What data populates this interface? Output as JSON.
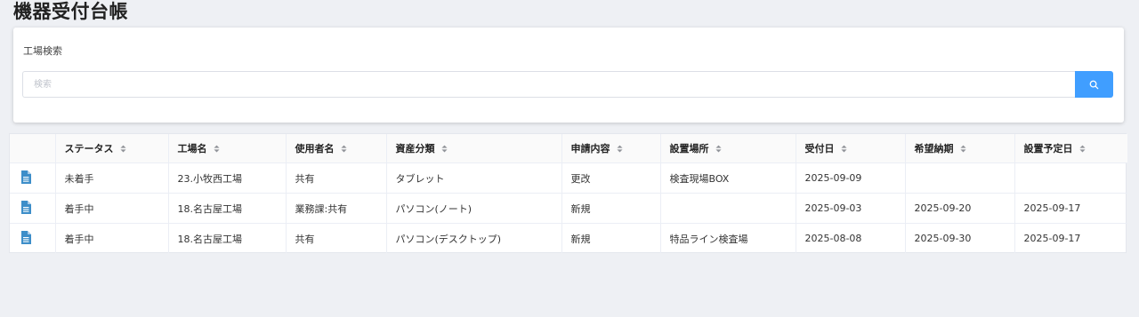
{
  "page": {
    "title": "機器受付台帳"
  },
  "search": {
    "label": "工場検索",
    "placeholder": "検索",
    "value": ""
  },
  "table": {
    "columns": [
      "",
      "ステータス",
      "工場名",
      "使用者名",
      "資産分類",
      "申請内容",
      "設置場所",
      "受付日",
      "希望納期",
      "設置予定日"
    ],
    "rows": [
      {
        "status": "未着手",
        "factory": "23.小牧西工場",
        "user": "共有",
        "asset_class": "タブレット",
        "request": "更改",
        "location": "検査現場BOX",
        "received": "2025-09-09",
        "desired_delivery": "",
        "planned_install": ""
      },
      {
        "status": "着手中",
        "factory": "18.名古屋工場",
        "user": "業務課:共有",
        "asset_class": "パソコン(ノート)",
        "request": "新規",
        "location": "",
        "received": "2025-09-03",
        "desired_delivery": "2025-09-20",
        "planned_install": "2025-09-17"
      },
      {
        "status": "着手中",
        "factory": "18.名古屋工場",
        "user": "共有",
        "asset_class": "パソコン(デスクトップ)",
        "request": "新規",
        "location": "特品ライン検査場",
        "received": "2025-08-08",
        "desired_delivery": "2025-09-30",
        "planned_install": "2025-09-17"
      }
    ]
  },
  "icons": {
    "row_icon": "document-icon",
    "search_button_icon": "search-icon",
    "sort_icon": "sort-icon"
  },
  "colors": {
    "primary": "#409eff",
    "document_icon": "#3d8ec9",
    "background": "#eef0f4"
  }
}
